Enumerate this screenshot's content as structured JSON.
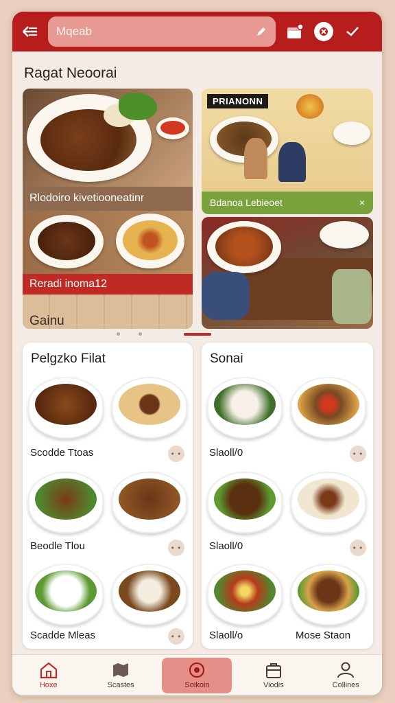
{
  "header": {
    "search_text": "Mqeab",
    "icons": [
      "back-arrow-icon",
      "edit-icon",
      "cart-icon",
      "settings-icon",
      "check-icon"
    ]
  },
  "section_title": "Ragat Neoorai",
  "featured": {
    "left_caption": "Rlodoiro kivetiooneatinr",
    "left_red_label": "Reradi inoma12",
    "left_bottom_text": "Gainu",
    "right_top_tag": "PRIANONN",
    "right_green_label": "Bdanoa Lebieoet",
    "right_green_close": "×"
  },
  "cards": [
    {
      "title": "Pelgzko Filat",
      "items": [
        {
          "label": "Scodde Ttoas"
        },
        {
          "label": "Beodle Tlou"
        },
        {
          "label": "Scadde Mleas"
        }
      ]
    },
    {
      "title": "Sonai",
      "items": [
        {
          "label": "Slaoll/0"
        },
        {
          "label": "Slaoll/0"
        },
        {
          "label": "Slaoll/o"
        },
        {
          "label": "Mose Staon"
        }
      ]
    }
  ],
  "more_button_text": "• •",
  "bottom_nav": [
    {
      "label": "Hoxe",
      "icon": "home-icon"
    },
    {
      "label": "Scastes",
      "icon": "map-icon"
    },
    {
      "label": "Soikoin",
      "icon": "target-icon"
    },
    {
      "label": "Viodis",
      "icon": "bag-icon"
    },
    {
      "label": "Collines",
      "icon": "user-icon"
    }
  ],
  "colors": {
    "primary": "#b81d1d",
    "accent_green": "#7aa23c",
    "background": "#f4ece4"
  }
}
